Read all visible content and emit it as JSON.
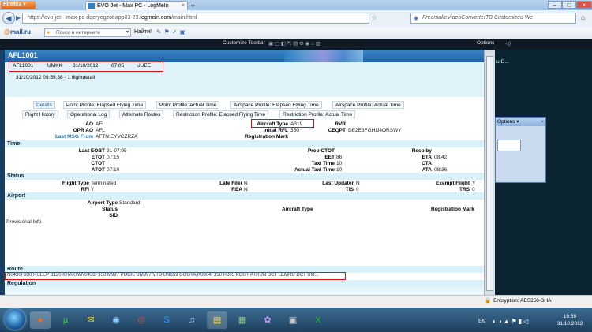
{
  "browser": {
    "app_button": "Firefox",
    "tab_title": "EVO Jet - Max PC - LogMeIn",
    "url_prefix": "https://",
    "url_host": "evo-jet---max-pc-dqeryegzot.app03-23.",
    "url_domain": "logmein.com",
    "url_path": "/main.html",
    "search_placeholder": "FreemakeVideoConverterTB Customized We"
  },
  "mailbar": {
    "logo_at": "@",
    "logo_text": "mail.ru",
    "search_placeholder": "Поиск в интернете",
    "find_button": "Найти!"
  },
  "lmi": {
    "customize": "Customize Toolbar",
    "options": "Options"
  },
  "right_panel": {
    "text1": "urD...",
    "options_label": "Options"
  },
  "flight": {
    "title": "AFL1001",
    "callsign": "AFL1001",
    "dep": "UMKK",
    "date": "31/10/2012",
    "time": "07:05",
    "dest": "UUEE",
    "timestamp": "31/10/2012 09:59:38 - 1 flightdetail"
  },
  "tabs_row1": [
    "Details",
    "Point Profile: Elapsed Flying Time",
    "Point Profile: Actual Time",
    "Airspace Profile: Elapsed Flying Time",
    "Airspace Profile: Actual Time"
  ],
  "tabs_row2": [
    "Flight History",
    "Operational Log",
    "Alternate Routes",
    "Restriction Profile: Elapsed Flying Time",
    "Restriction Profile: Actual Time"
  ],
  "general": {
    "ao_label": "AO",
    "ao_value": "AFL",
    "opr_label": "OPR AO",
    "opr_value": "AFL",
    "lastmsg_label": "Last MSG From",
    "lastmsg_value": "AFTN:EYVCZRZA",
    "actype_label": "Aircraft Type",
    "actype_value": "A319",
    "initrfl_label": "Initial RFL",
    "initrfl_value": "350",
    "regmark_label": "Registration Mark",
    "rvr_label": "RVR",
    "ceqpt_label": "CEQPT",
    "ceqpt_value": "DE2E3FGHIJ4ORSWY"
  },
  "time_section": {
    "title": "Time",
    "lastEobt_label": "Last EOBT",
    "lastEobt": "31-07:05",
    "etot_label": "ETOT",
    "etot": "07:15",
    "ctot_label": "CTOT",
    "ctot": "",
    "atot_label": "ATOT",
    "atot": "07:10",
    "propctot_label": "Prop CTOT",
    "eet_label": "EET",
    "eet": "86",
    "taxi_label": "Taxi Time",
    "taxi": "10",
    "acttaxi_label": "Actual Taxi Time",
    "acttaxi": "10",
    "resp_label": "Resp by",
    "eta_label": "ETA",
    "eta": "08:42",
    "cta_label": "CTA",
    "ata_label": "ATA",
    "ata": "08:36"
  },
  "status_section": {
    "title": "Status",
    "ftype_label": "Flight Type",
    "ftype": "Terminated",
    "rfi_label": "RFI",
    "rfi": "Y",
    "latefiler_label": "Late Filer",
    "latefiler": "N",
    "rea_label": "REA",
    "rea": "N",
    "lastupd_label": "Last Updater",
    "lastupd": "N",
    "tis_label": "TIS",
    "tis": "0",
    "exempt_label": "Exempt Flight",
    "exempt": "Y",
    "trs_label": "TRS",
    "trs": "0"
  },
  "airport_section": {
    "title": "Airport",
    "aptype_label": "Airport Type",
    "aptype": "Standard",
    "status_label": "Status",
    "sid_label": "SID",
    "actype_label": "Aircraft Type",
    "reg_label": "Registration Mark",
    "prov_label": "Provisional Info"
  },
  "route_section": {
    "title": "Route",
    "route": "N0430F330 RULEP B120 KRAKW/N0438F350 M997 POGIL UM997 VTB UN859 GOGTA/K0804F350 R805 KOGT ATRUN DCT LEMRU DCT UM..."
  },
  "regulation_section": {
    "title": "Regulation"
  },
  "statusbar": {
    "encryption": "Encryption: AES256-SHA"
  },
  "taskbar": {
    "lang": "EN",
    "time": "10:59",
    "date": "31.10.2012"
  },
  "colors": {
    "header_blue": "#1e62a4",
    "section_cyan": "#d9f1f8",
    "highlight_red": "#dd1111"
  }
}
